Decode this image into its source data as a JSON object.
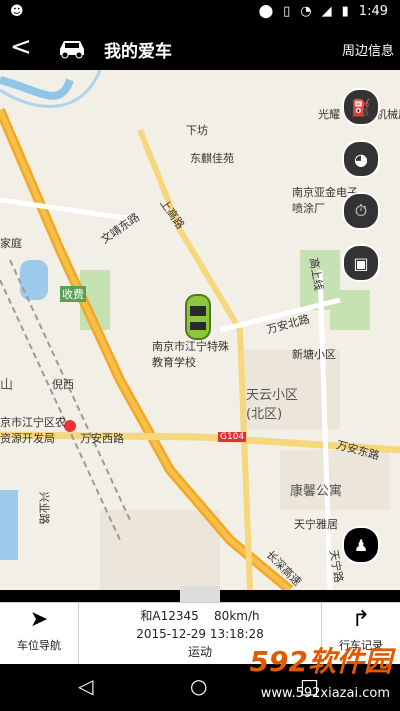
{
  "status": {
    "time": "1:49"
  },
  "header": {
    "title": "我的爱车",
    "right_label": "周边信息"
  },
  "map": {
    "labels": {
      "xiafang": "下坊",
      "dongqi": "东麒佳苑",
      "guangyao": "光耀",
      "jixie": "机械厂",
      "nanjing_ind": "南京亚金电子喷涂厂",
      "wenjing": "文靖东路",
      "shanggao": "上高路",
      "jiatingyuan": "家庭",
      "shoufei": "收费",
      "school": "南京市江宁特殊教育学校",
      "wanan_n": "万安北路",
      "gaoshang": "高上线",
      "xintang": "新塘小区",
      "tianyun": "天云小区(北区)",
      "nixi": "倪西",
      "shan": "山",
      "jiangning": "京市江宁区农资源开发局",
      "wanan_w": "万安西路",
      "g104": "G104",
      "wanan_e": "万安东路",
      "kangxin": "康馨公寓",
      "tianning": "天宁雅居",
      "xingye": "兴业路",
      "changcheng": "长深高速",
      "tianning_rd": "天宁路"
    }
  },
  "bottom": {
    "nav_label": "车位导航",
    "plate": "和A12345",
    "speed": "80km/h",
    "datetime": "2015-12-29 13:18:28",
    "state": "运动",
    "record_label": "行车记录"
  },
  "watermark": {
    "brand": "592软件园",
    "url": "www.592xiazai.com"
  }
}
